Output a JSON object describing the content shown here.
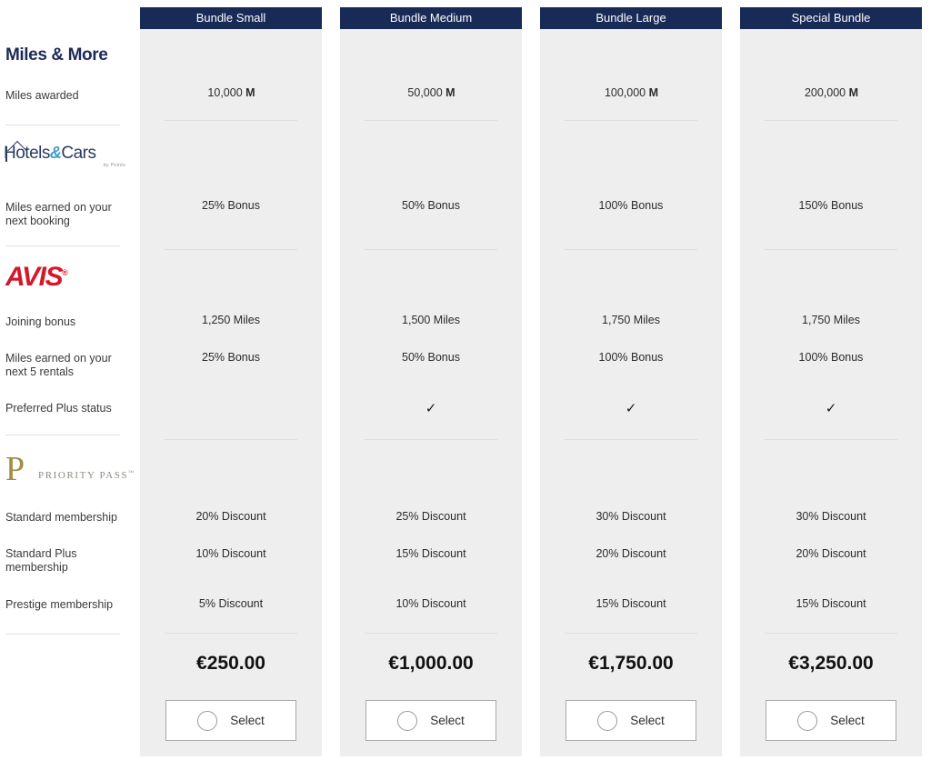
{
  "page": {
    "background": "#ffffff",
    "header_color": "#182a56",
    "column_bg": "#eeeeee"
  },
  "sidebar": {
    "brands": [
      {
        "id": "miles-and-more",
        "name": "Miles & More",
        "color": "#1c2a58"
      },
      {
        "id": "hotels-and-cars",
        "name": "Hotels & Cars",
        "tagline": "by Points",
        "color": "#2a3b63",
        "accent": "#3f9fc4"
      },
      {
        "id": "avis",
        "name": "AVIS",
        "color": "#d4182b"
      },
      {
        "id": "priority-pass",
        "name": "PRIORITY PASS",
        "initial": "P",
        "color": "#a68b43"
      }
    ],
    "features": [
      {
        "id": "miles-awarded",
        "label": "Miles awarded"
      },
      {
        "id": "miles-next-booking",
        "label": "Miles earned on your next booking"
      },
      {
        "id": "joining-bonus",
        "label": "Joining bonus"
      },
      {
        "id": "miles-next-5-rentals",
        "label": "Miles earned on your next 5 rentals"
      },
      {
        "id": "preferred-plus-status",
        "label": "Preferred Plus status"
      },
      {
        "id": "standard-membership",
        "label": "Standard membership"
      },
      {
        "id": "standard-plus-membership",
        "label": "Standard Plus membership"
      },
      {
        "id": "prestige-membership",
        "label": "Prestige membership"
      }
    ]
  },
  "columns": [
    {
      "id": "bundle-small",
      "header": "Bundle Small",
      "miles_awarded": "10,000",
      "miles_symbol": "M",
      "miles_next_booking": "25% Bonus",
      "joining_bonus": "1,250 Miles",
      "miles_next_5_rentals": "25% Bonus",
      "preferred_plus_status": "",
      "standard_membership": "20% Discount",
      "standard_plus_membership": "10% Discount",
      "prestige_membership": "5% Discount",
      "price": "€250.00",
      "select_label": "Select"
    },
    {
      "id": "bundle-medium",
      "header": "Bundle Medium",
      "miles_awarded": "50,000",
      "miles_symbol": "M",
      "miles_next_booking": "50% Bonus",
      "joining_bonus": "1,500 Miles",
      "miles_next_5_rentals": "50% Bonus",
      "preferred_plus_status": "✓",
      "standard_membership": "25% Discount",
      "standard_plus_membership": "15% Discount",
      "prestige_membership": "10% Discount",
      "price": "€1,000.00",
      "select_label": "Select"
    },
    {
      "id": "bundle-large",
      "header": "Bundle Large",
      "miles_awarded": "100,000",
      "miles_symbol": "M",
      "miles_next_booking": "100% Bonus",
      "joining_bonus": "1,750 Miles",
      "miles_next_5_rentals": "100% Bonus",
      "preferred_plus_status": "✓",
      "standard_membership": "30% Discount",
      "standard_plus_membership": "20% Discount",
      "prestige_membership": "15% Discount",
      "price": "€1,750.00",
      "select_label": "Select"
    },
    {
      "id": "special-bundle",
      "header": "Special Bundle",
      "miles_awarded": "200,000",
      "miles_symbol": "M",
      "miles_next_booking": "150% Bonus",
      "joining_bonus": "1,750 Miles",
      "miles_next_5_rentals": "100% Bonus",
      "preferred_plus_status": "✓",
      "standard_membership": "30% Discount",
      "standard_plus_membership": "20% Discount",
      "prestige_membership": "15% Discount",
      "price": "€3,250.00",
      "select_label": "Select"
    }
  ]
}
